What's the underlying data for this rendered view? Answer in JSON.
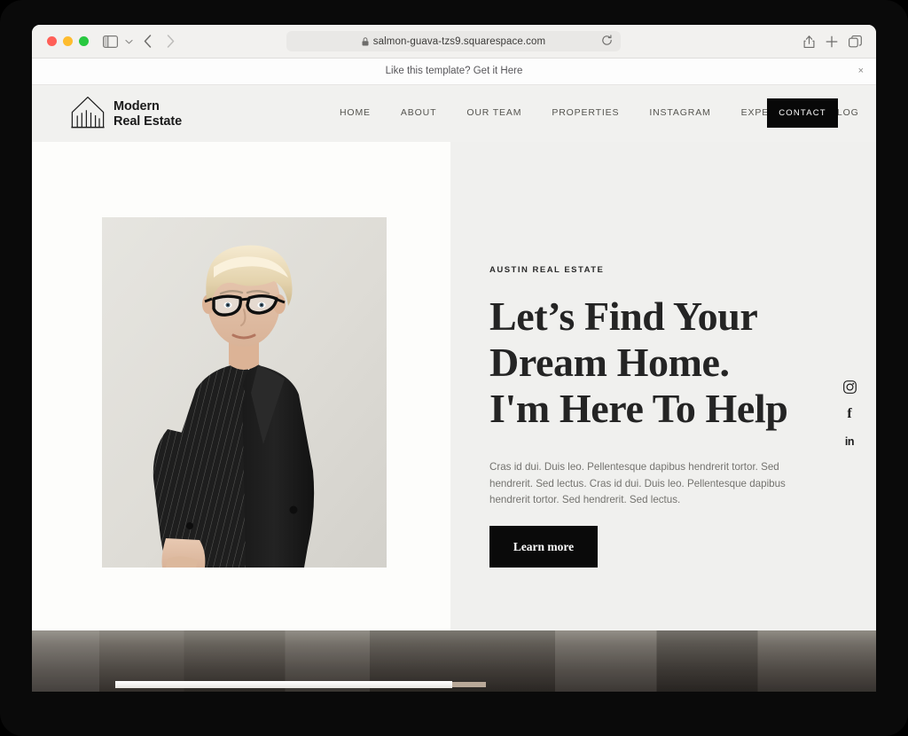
{
  "browser": {
    "url": "salmon-guava-tzs9.squarespace.com",
    "lock_icon": "lock-icon",
    "reload_icon": "reload-icon",
    "sidebar_icon": "sidebar-toggle-icon",
    "sidebar_chevron_icon": "chevron-down-icon",
    "back_icon": "chevron-left-icon",
    "forward_icon": "chevron-right-icon",
    "share_icon": "share-icon",
    "newtab_icon": "plus-icon",
    "tabs_icon": "tab-overview-icon",
    "traffic_lights": {
      "close": "#ff5f57",
      "minimize": "#febc2e",
      "maximize": "#28c840"
    }
  },
  "promo": {
    "text": "Like this template? Get it Here",
    "close_label": "×"
  },
  "site": {
    "logo": {
      "text": "Modern\nReal Estate",
      "icon": "building-logo-icon"
    },
    "nav": [
      {
        "label": "HOME"
      },
      {
        "label": "ABOUT"
      },
      {
        "label": "OUR TEAM"
      },
      {
        "label": "PROPERTIES"
      },
      {
        "label": "INSTAGRAM"
      },
      {
        "label": "EXPERTISE"
      },
      {
        "label": "BLOG"
      }
    ],
    "contact_button": "CONTACT"
  },
  "hero": {
    "eyebrow": "AUSTIN REAL ESTATE",
    "headline": "Let’s Find Your\nDream Home.\nI'm Here To Help",
    "body": "Cras id dui. Duis leo. Pellentesque dapibus hendrerit tortor. Sed hendrerit. Sed lectus. Cras id dui. Duis leo. Pellentesque dapibus hendrerit tortor. Sed hendrerit. Sed lectus.",
    "cta": "Learn more",
    "portrait_alt": "Real estate agent portrait",
    "left_bg": "#fdfdfb",
    "right_bg": "#f0f0ee"
  },
  "social": [
    {
      "name": "instagram-icon",
      "label": "Instagram"
    },
    {
      "name": "facebook-icon",
      "label": "f"
    },
    {
      "name": "linkedin-icon",
      "label": "in"
    }
  ],
  "colors": {
    "accent_dark": "#0a0a0a",
    "text_dark": "#242424",
    "text_muted": "#74736f",
    "header_bg": "#f1f1ef"
  }
}
